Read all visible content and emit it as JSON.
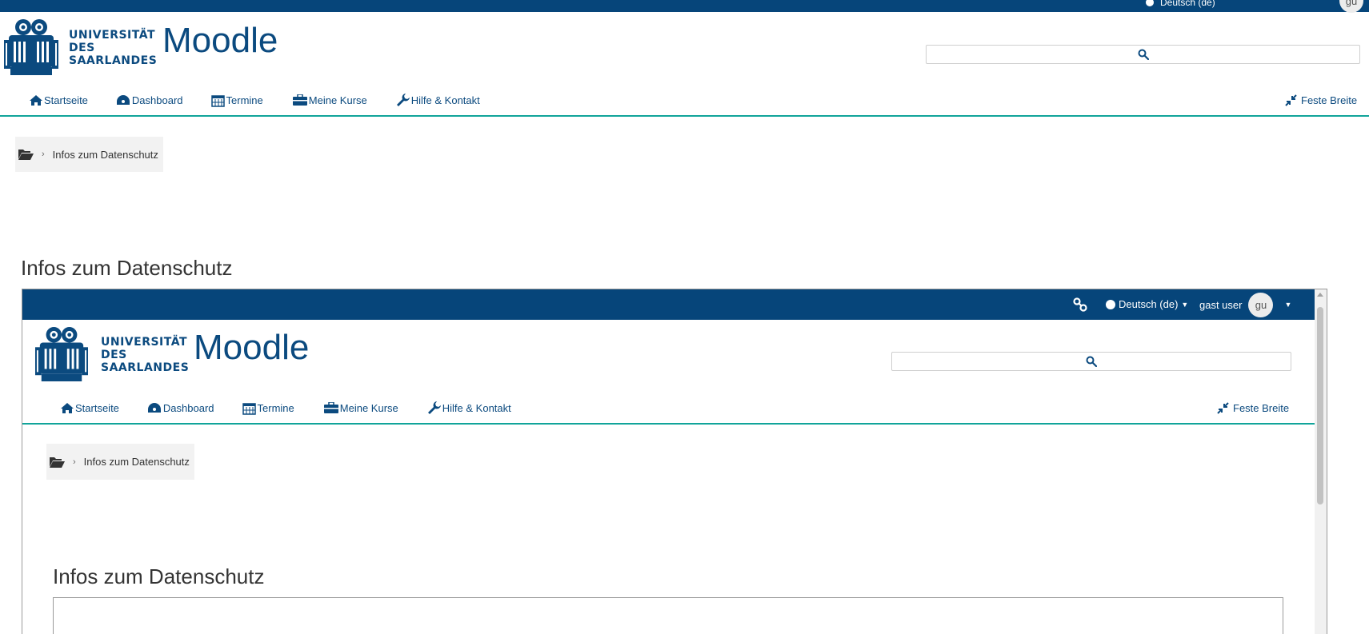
{
  "colors": {
    "brand": "#06457a",
    "accent": "#11a49a",
    "breadcrumb_bg": "#f2f2f2"
  },
  "header": {
    "university_lines": [
      "UNIVERSITÄT",
      "DES",
      "SAARLANDES"
    ],
    "app_name": "Moodle",
    "language": "Deutsch (de)",
    "user_name": "gast user",
    "avatar_initials": "gu"
  },
  "nav": {
    "items": [
      {
        "label": "Startseite",
        "icon": "home-icon"
      },
      {
        "label": "Dashboard",
        "icon": "dashboard-icon"
      },
      {
        "label": "Termine",
        "icon": "calendar-icon"
      },
      {
        "label": "Meine Kurse",
        "icon": "briefcase-icon"
      },
      {
        "label": "Hilfe & Kontakt",
        "icon": "wrench-icon"
      }
    ],
    "width_toggle": "Feste Breite"
  },
  "breadcrumb": {
    "current": "Infos zum Datenschutz"
  },
  "page": {
    "title": "Infos zum Datenschutz"
  },
  "embedded": {
    "page_title": "Infos zum Datenschutz"
  }
}
